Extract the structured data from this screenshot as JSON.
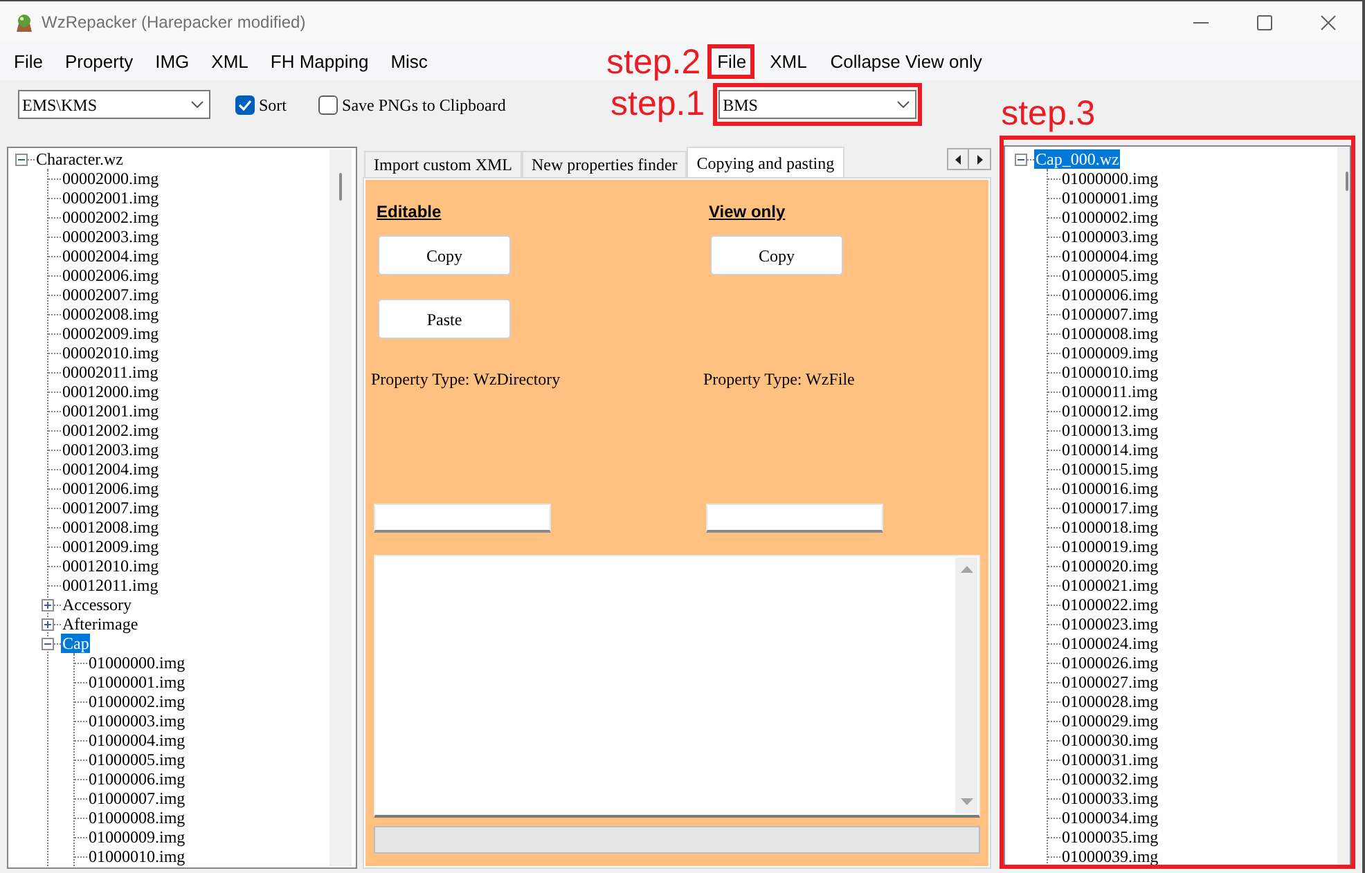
{
  "window": {
    "title": "WzRepacker (Harepacker modified)"
  },
  "menu_bar": [
    "File",
    "Property",
    "IMG",
    "XML",
    "FH Mapping",
    "Misc"
  ],
  "second_menu_bar": {
    "annotation": "step.2",
    "items": [
      {
        "label": "File",
        "highlighted": true
      },
      {
        "label": "XML",
        "highlighted": false
      },
      {
        "label": "Collapse View only",
        "highlighted": false
      }
    ]
  },
  "toolbar": {
    "dropdown": {
      "value": "EMS\\KMS"
    },
    "checkboxes": [
      {
        "label": "Sort",
        "checked": true
      },
      {
        "label": "Save PNGs to Clipboard",
        "checked": false
      }
    ]
  },
  "second_dropdown": {
    "annotation": "step.1",
    "value": "BMS",
    "highlighted": true
  },
  "left_tree": {
    "nodes": [
      {
        "label": "Character.wz",
        "expanded": true,
        "selected": false,
        "children": [
          {
            "label": "00002000.img",
            "selected": false
          },
          {
            "label": "00002001.img",
            "selected": false
          },
          {
            "label": "00002002.img",
            "selected": false
          },
          {
            "label": "00002003.img",
            "selected": false
          },
          {
            "label": "00002004.img",
            "selected": false
          },
          {
            "label": "00002006.img",
            "selected": false
          },
          {
            "label": "00002007.img",
            "selected": false
          },
          {
            "label": "00002008.img",
            "selected": false
          },
          {
            "label": "00002009.img",
            "selected": false
          },
          {
            "label": "00002010.img",
            "selected": false
          },
          {
            "label": "00002011.img",
            "selected": false
          },
          {
            "label": "00012000.img",
            "selected": false
          },
          {
            "label": "00012001.img",
            "selected": false
          },
          {
            "label": "00012002.img",
            "selected": false
          },
          {
            "label": "00012003.img",
            "selected": false
          },
          {
            "label": "00012004.img",
            "selected": false
          },
          {
            "label": "00012006.img",
            "selected": false
          },
          {
            "label": "00012007.img",
            "selected": false
          },
          {
            "label": "00012008.img",
            "selected": false
          },
          {
            "label": "00012009.img",
            "selected": false
          },
          {
            "label": "00012010.img",
            "selected": false
          },
          {
            "label": "00012011.img",
            "selected": false
          },
          {
            "label": "Accessory",
            "expanded": false,
            "selected": false
          },
          {
            "label": "Afterimage",
            "expanded": false,
            "selected": false
          },
          {
            "label": "Cap",
            "expanded": true,
            "selected": true,
            "children": [
              {
                "label": "01000000.img",
                "selected": false
              },
              {
                "label": "01000001.img",
                "selected": false
              },
              {
                "label": "01000002.img",
                "selected": false
              },
              {
                "label": "01000003.img",
                "selected": false
              },
              {
                "label": "01000004.img",
                "selected": false
              },
              {
                "label": "01000005.img",
                "selected": false
              },
              {
                "label": "01000006.img",
                "selected": false
              },
              {
                "label": "01000007.img",
                "selected": false
              },
              {
                "label": "01000008.img",
                "selected": false
              },
              {
                "label": "01000009.img",
                "selected": false
              },
              {
                "label": "01000010.img",
                "selected": false
              }
            ]
          }
        ]
      }
    ]
  },
  "tabs": [
    {
      "label": "Import custom XML",
      "selected": false
    },
    {
      "label": "New properties finder",
      "selected": false
    },
    {
      "label": "Copying and pasting",
      "selected": true
    }
  ],
  "copy_paste_panel": {
    "columns": [
      {
        "heading": "Editable",
        "buttons": [
          "Copy",
          "Paste"
        ],
        "property_type": "Property Type: WzDirectory"
      },
      {
        "heading": "View only",
        "buttons": [
          "Copy"
        ],
        "property_type": "Property Type: WzFile"
      }
    ]
  },
  "right_tree": {
    "annotation": "step.3",
    "highlighted": true,
    "nodes": [
      {
        "label": "Cap_000.wz",
        "expanded": true,
        "selected": true,
        "children": [
          {
            "label": "01000000.img",
            "selected": false
          },
          {
            "label": "01000001.img",
            "selected": false
          },
          {
            "label": "01000002.img",
            "selected": false
          },
          {
            "label": "01000003.img",
            "selected": false
          },
          {
            "label": "01000004.img",
            "selected": false
          },
          {
            "label": "01000005.img",
            "selected": false
          },
          {
            "label": "01000006.img",
            "selected": false
          },
          {
            "label": "01000007.img",
            "selected": false
          },
          {
            "label": "01000008.img",
            "selected": false
          },
          {
            "label": "01000009.img",
            "selected": false
          },
          {
            "label": "01000010.img",
            "selected": false
          },
          {
            "label": "01000011.img",
            "selected": false
          },
          {
            "label": "01000012.img",
            "selected": false
          },
          {
            "label": "01000013.img",
            "selected": false
          },
          {
            "label": "01000014.img",
            "selected": false
          },
          {
            "label": "01000015.img",
            "selected": false
          },
          {
            "label": "01000016.img",
            "selected": false
          },
          {
            "label": "01000017.img",
            "selected": false
          },
          {
            "label": "01000018.img",
            "selected": false
          },
          {
            "label": "01000019.img",
            "selected": false
          },
          {
            "label": "01000020.img",
            "selected": false
          },
          {
            "label": "01000021.img",
            "selected": false
          },
          {
            "label": "01000022.img",
            "selected": false
          },
          {
            "label": "01000023.img",
            "selected": false
          },
          {
            "label": "01000024.img",
            "selected": false
          },
          {
            "label": "01000026.img",
            "selected": false
          },
          {
            "label": "01000027.img",
            "selected": false
          },
          {
            "label": "01000028.img",
            "selected": false
          },
          {
            "label": "01000029.img",
            "selected": false
          },
          {
            "label": "01000030.img",
            "selected": false
          },
          {
            "label": "01000031.img",
            "selected": false
          },
          {
            "label": "01000032.img",
            "selected": false
          },
          {
            "label": "01000033.img",
            "selected": false
          },
          {
            "label": "01000034.img",
            "selected": false
          },
          {
            "label": "01000035.img",
            "selected": false
          },
          {
            "label": "01000039.img",
            "selected": false
          }
        ]
      }
    ]
  }
}
